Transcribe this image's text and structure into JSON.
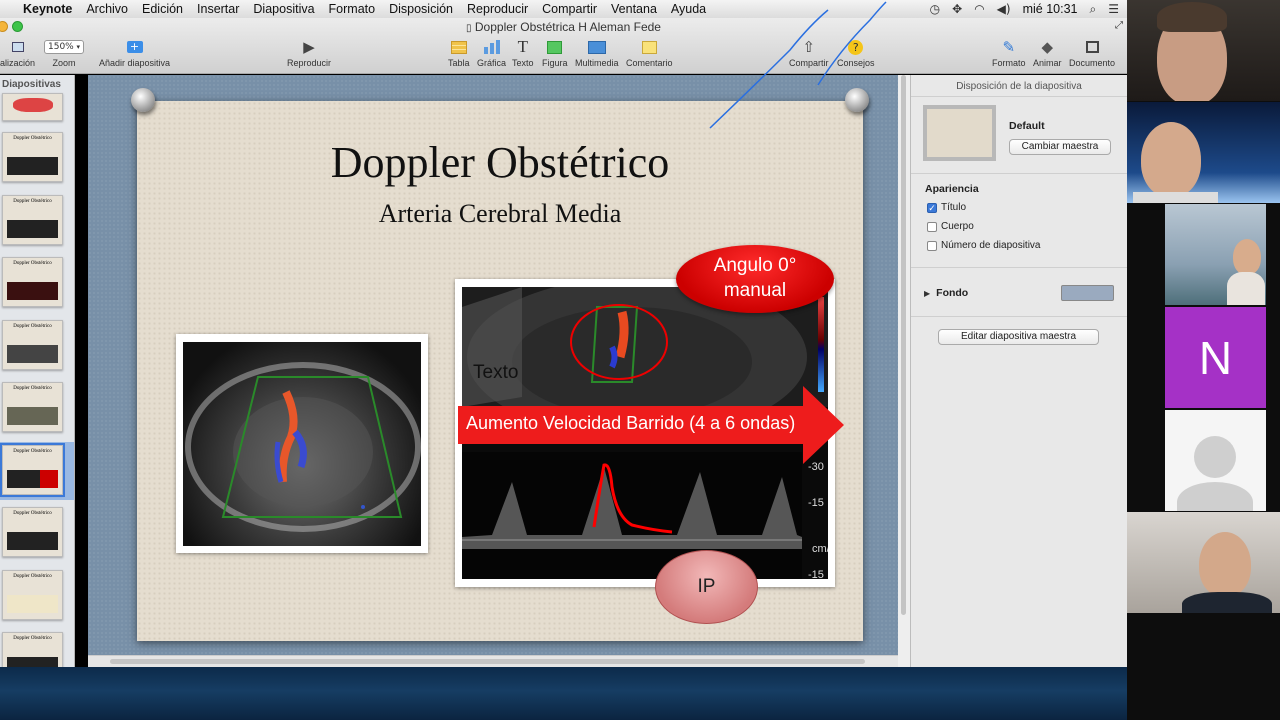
{
  "menubar": {
    "app": "Keynote",
    "items": [
      "Archivo",
      "Edición",
      "Insertar",
      "Diapositiva",
      "Formato",
      "Disposición",
      "Reproducir",
      "Compartir",
      "Ventana",
      "Ayuda"
    ],
    "clock": "mié 10:31"
  },
  "window": {
    "title": "Doppler Obstétrica H Aleman Fede"
  },
  "toolbar": {
    "visualizacion_label": "alización",
    "zoom_value": "150%",
    "zoom_label": "Zoom",
    "add_slide_label": "Añadir diapositiva",
    "play_label": "Reproducir",
    "table_label": "Tabla",
    "chart_label": "Gráfica",
    "text_label": "Texto",
    "shape_label": "Figura",
    "media_label": "Multimedia",
    "comment_label": "Comentario",
    "share_label": "Compartir",
    "tips_label": "Consejos",
    "format_label": "Formato",
    "animate_label": "Animar",
    "document_label": "Documento"
  },
  "sidebar": {
    "header": "Diapositivas",
    "thumb_title": "Doppler Obstétrico"
  },
  "slide": {
    "title": "Doppler Obstétrico",
    "subtitle": "Arteria Cerebral Media",
    "angle_bubble_line1": "Angulo 0°",
    "angle_bubble_line2": "manual",
    "banner_text": "Aumento Velocidad Barrido (4 a 6 ondas)",
    "placeholder_text": "Texto",
    "ip_bubble": "IP",
    "scale_labels": [
      "-30",
      "-15",
      "cm/",
      "-15"
    ]
  },
  "inspector": {
    "header": "Disposición de la diapositiva",
    "master_name": "Default",
    "change_master_label": "Cambiar maestra",
    "appearance_label": "Apariencia",
    "checkboxes": [
      {
        "label": "Título",
        "checked": true
      },
      {
        "label": "Cuerpo",
        "checked": false
      },
      {
        "label": "Número de diapositiva",
        "checked": false
      }
    ],
    "background_label": "Fondo",
    "background_color": "#9aaabf",
    "edit_master_label": "Editar diapositiva maestra"
  },
  "video_call": {
    "participant_initial": "N",
    "initial_tile_color": "#a531c6"
  }
}
